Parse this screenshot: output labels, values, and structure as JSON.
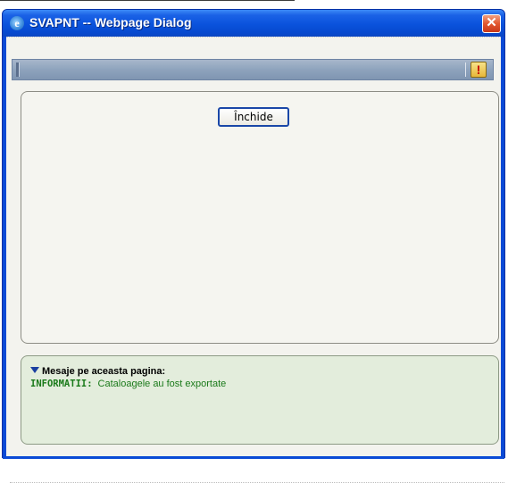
{
  "window": {
    "title": "SVAPNT -- Webpage Dialog",
    "close_glyph": "✕",
    "icon": "ie-icon"
  },
  "toolbar": {
    "alert_icon": "exclamation-icon",
    "alert_glyph": "!"
  },
  "content": {
    "close_button_label": "Închide"
  },
  "messages": {
    "header": "Mesaje pe aceasta pagina:",
    "items": [
      {
        "label": "INFORMATII:",
        "text": "Cataloagele au fost exportate"
      }
    ]
  },
  "colors": {
    "titlebar": "#0a52dc",
    "info_text": "#1a7a1a",
    "message_panel_bg": "#e3eddc"
  }
}
